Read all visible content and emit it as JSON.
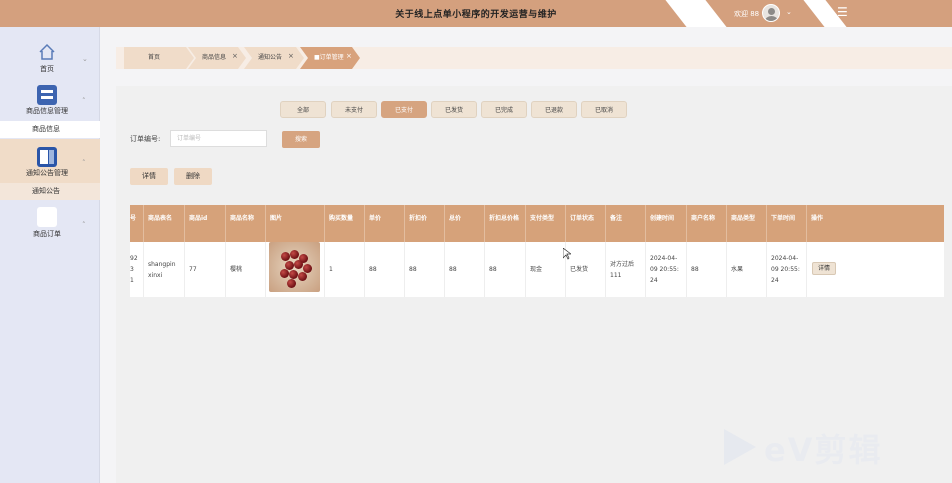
{
  "header": {
    "title": "关于线上点单小程序的开发运营与维护",
    "user": "欢迎 88",
    "menu_icon": "hamburger-icon"
  },
  "sidebar": {
    "items": [
      {
        "label": "首页",
        "icon": "home-icon"
      },
      {
        "label": "商品信息管理",
        "icon": "database-icon",
        "sub": "商品信息"
      },
      {
        "label": "通知公告管理",
        "icon": "panel-icon",
        "sub": "通知公告"
      },
      {
        "label": "商品订单",
        "icon": "blank-icon"
      }
    ]
  },
  "breadcrumbs": [
    {
      "label": "首页"
    },
    {
      "label": "商品信息"
    },
    {
      "label": "通知公告"
    },
    {
      "label": "■订单管理"
    }
  ],
  "tabs": [
    "全部",
    "未支付",
    "已支付",
    "已发货",
    "已完成",
    "已退款",
    "已取消"
  ],
  "active_tab": "已支付",
  "search": {
    "label": "订单编号:",
    "placeholder": "订单编号",
    "button": "搜索"
  },
  "actions": {
    "detail": "详情",
    "delete": "删除"
  },
  "table": {
    "columns": [
      "号",
      "商品表名",
      "商品id",
      "商品名称",
      "图片",
      "购买数量",
      "单价",
      "折扣价",
      "总价",
      "折扣总价格",
      "支付类型",
      "订单状态",
      "备注",
      "创建时间",
      "商户名称",
      "商品类型",
      "下单时间",
      "操作"
    ],
    "row": {
      "no": "92\n3\n1",
      "table_name": "shangpin\nxinxi",
      "goods_id": "77",
      "goods_name": "樱桃",
      "image": "cherry-photo",
      "qty": "1",
      "price": "88",
      "discount_price": "88",
      "total": "88",
      "discount_total": "88",
      "pay_type": "现金",
      "status": "已发货",
      "remark": "对方过后\n111",
      "created": "2024-04-\n09 20:55:\n24",
      "merchant": "88",
      "goods_type": "水果",
      "order_time": "2024-04-\n09 20:55:\n24",
      "op": "详情"
    }
  },
  "watermark": "eV剪辑",
  "colors": {
    "primary": "#d6a27a",
    "header": "#d4a07e",
    "sidebar": "#e4e7f4"
  }
}
